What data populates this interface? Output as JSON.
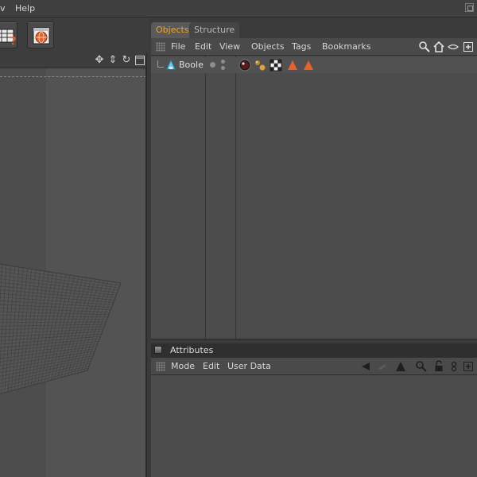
{
  "menubar": {
    "items": [
      {
        "label": "v"
      },
      {
        "label": "Help"
      }
    ]
  },
  "toolbar": {
    "buttons": [
      {
        "icon": "render-settings-icon"
      },
      {
        "icon": "render-globe-icon"
      }
    ]
  },
  "viewport": {
    "header_icons": [
      "move-icon",
      "zoom-icon",
      "rotate-icon",
      "maximize-icon"
    ]
  },
  "objects_manager": {
    "tabs": [
      {
        "label": "Objects",
        "active": true
      },
      {
        "label": "Structure",
        "active": false
      }
    ],
    "menu": [
      "File",
      "Edit",
      "View",
      "Objects",
      "Tags",
      "Bookmarks"
    ],
    "toolbar_icons": [
      "search-icon",
      "home-icon",
      "eye-icon",
      "new-window-icon"
    ],
    "objects": [
      {
        "name": "Boole",
        "icon": "boole-icon",
        "tags": [
          "material-tag-icon",
          "spheres-tag-icon",
          "checker-tag-icon",
          "triangle-tag-icon",
          "triangle-tag-icon"
        ]
      }
    ]
  },
  "attributes": {
    "title": "Attributes",
    "menu": [
      "Mode",
      "Edit",
      "User Data"
    ],
    "toolbar_icons": [
      "back-arrow-icon",
      "forward-arrow-icon",
      "up-arrow-icon",
      "search-icon",
      "lock-icon",
      "link-icon",
      "new-window-icon"
    ]
  },
  "colors": {
    "active_tab": "#f5a623",
    "tag_orange": "#e8602c",
    "background": "#3b3b3b"
  }
}
